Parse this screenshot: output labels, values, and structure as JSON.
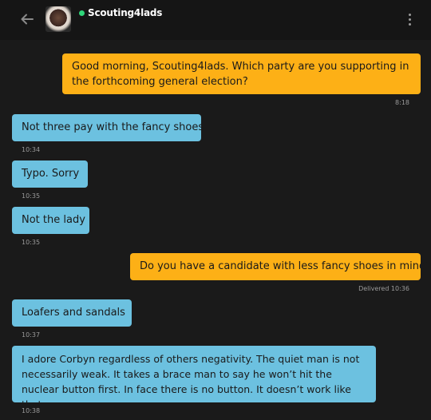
{
  "header": {
    "username": "Scouting4lads",
    "online": true
  },
  "messages": [
    {
      "direction": "sent",
      "text": "Good morning, Scouting4lads. Which party are you supporting in the forthcoming general election?",
      "time": "8:18"
    },
    {
      "direction": "received",
      "text": "Not three pay with the fancy shoes",
      "time": "10:34"
    },
    {
      "direction": "received",
      "text": "Typo. Sorry",
      "time": "10:35"
    },
    {
      "direction": "received",
      "text": "Not the lady",
      "time": "10:35"
    },
    {
      "direction": "sent",
      "text": "Do you have a candidate with less fancy shoes in mind?",
      "time": "Delivered 10:36"
    },
    {
      "direction": "received",
      "text": "Loafers and sandals",
      "time": "10:37"
    },
    {
      "direction": "received",
      "text": "I adore Corbyn regardless of others negativity. The quiet man is not necessarily weak. It takes a brace man to say he won’t hit the nuclear button first.  In face there is no button. It doesn’t work like that.",
      "time": "10:38"
    }
  ],
  "colors": {
    "sent_bubble": "#fdb016",
    "received_bubble": "#6cc1e0",
    "background": "#1a1a1a",
    "header": "#151515",
    "online_dot": "#2fd67a"
  }
}
